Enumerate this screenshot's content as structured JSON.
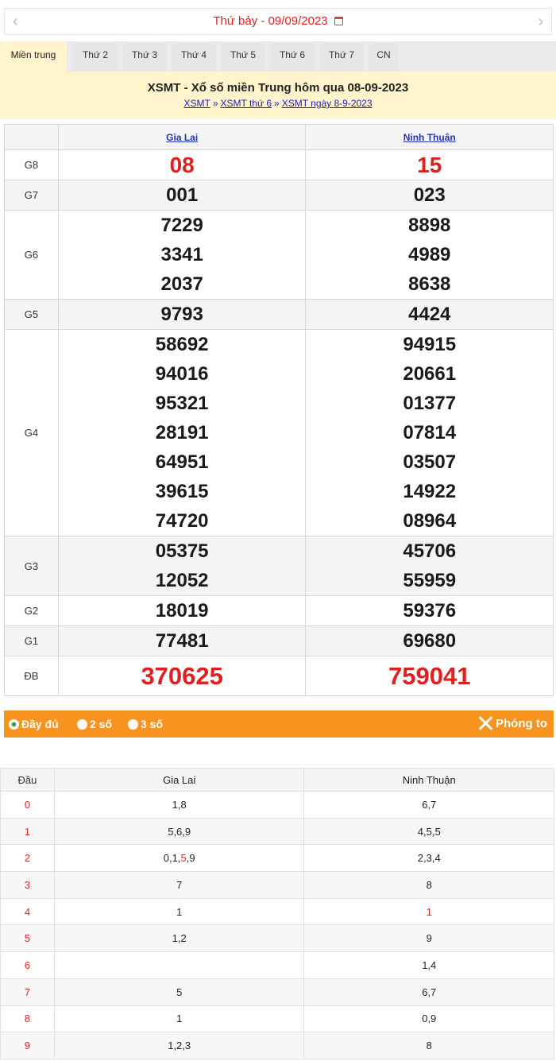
{
  "date_bar": {
    "prev": "‹",
    "next": "›",
    "date_text": "Thứ bảy -  09/09/2023"
  },
  "tabs": [
    "Miền trung",
    "Thứ 2",
    "Thứ 3",
    "Thứ 4",
    "Thứ 5",
    "Thứ 6",
    "Thứ 7",
    "CN"
  ],
  "header": {
    "title": "XSMT - Xổ số miền Trung hôm qua 08-09-2023",
    "crumbs": [
      "XSMT",
      "XSMT thứ 6",
      "XSMT ngày 8-9-2023"
    ],
    "sep": "»"
  },
  "results": {
    "provinces": [
      "Gia Lai",
      "Ninh Thuận"
    ],
    "prizes": [
      {
        "label": "G8",
        "gia_lai": [
          "08"
        ],
        "ninh_thuan": [
          "15"
        ]
      },
      {
        "label": "G7",
        "gia_lai": [
          "001"
        ],
        "ninh_thuan": [
          "023"
        ]
      },
      {
        "label": "G6",
        "gia_lai": [
          "7229",
          "3341",
          "2037"
        ],
        "ninh_thuan": [
          "8898",
          "4989",
          "8638"
        ]
      },
      {
        "label": "G5",
        "gia_lai": [
          "9793"
        ],
        "ninh_thuan": [
          "4424"
        ]
      },
      {
        "label": "G4",
        "gia_lai": [
          "58692",
          "94016",
          "95321",
          "28191",
          "64951",
          "39615",
          "74720"
        ],
        "ninh_thuan": [
          "94915",
          "20661",
          "01377",
          "07814",
          "03507",
          "14922",
          "08964"
        ]
      },
      {
        "label": "G3",
        "gia_lai": [
          "05375",
          "12052"
        ],
        "ninh_thuan": [
          "45706",
          "55959"
        ]
      },
      {
        "label": "G2",
        "gia_lai": [
          "18019"
        ],
        "ninh_thuan": [
          "59376"
        ]
      },
      {
        "label": "G1",
        "gia_lai": [
          "77481"
        ],
        "ninh_thuan": [
          "69680"
        ]
      },
      {
        "label": "ĐB",
        "gia_lai": [
          "370625"
        ],
        "ninh_thuan": [
          "759041"
        ]
      }
    ]
  },
  "options": {
    "full": "Đầy đủ",
    "two": "2 số",
    "three": "3 số",
    "zoom": "Phóng to"
  },
  "loto": {
    "head_label": "Đầu",
    "provinces": [
      "Gia Lai",
      "Ninh Thuận"
    ],
    "rows": [
      {
        "head": "0",
        "gia_lai": "1,8",
        "ninh_thuan": "6,7"
      },
      {
        "head": "1",
        "gia_lai": "5,6,9",
        "ninh_thuan": "4,5,5"
      },
      {
        "head": "2",
        "gia_lai_parts": [
          "0,1,",
          "5",
          ",9"
        ],
        "ninh_thuan": "2,3,4"
      },
      {
        "head": "3",
        "gia_lai": "7",
        "ninh_thuan": "8"
      },
      {
        "head": "4",
        "gia_lai": "1",
        "ninh_thuan": "1"
      },
      {
        "head": "5",
        "gia_lai": "1,2",
        "ninh_thuan": "9"
      },
      {
        "head": "6",
        "gia_lai": "",
        "ninh_thuan": "1,4"
      },
      {
        "head": "7",
        "gia_lai": "5",
        "ninh_thuan": "6,7"
      },
      {
        "head": "8",
        "gia_lai": "1",
        "ninh_thuan": "0,9"
      },
      {
        "head": "9",
        "gia_lai": "1,2,3",
        "ninh_thuan": "8"
      }
    ]
  },
  "colors": {
    "accent_red": "#e02020",
    "orange_bar": "#f7931e",
    "header_bg": "#fff4cc",
    "link_blue": "#2233bb"
  }
}
